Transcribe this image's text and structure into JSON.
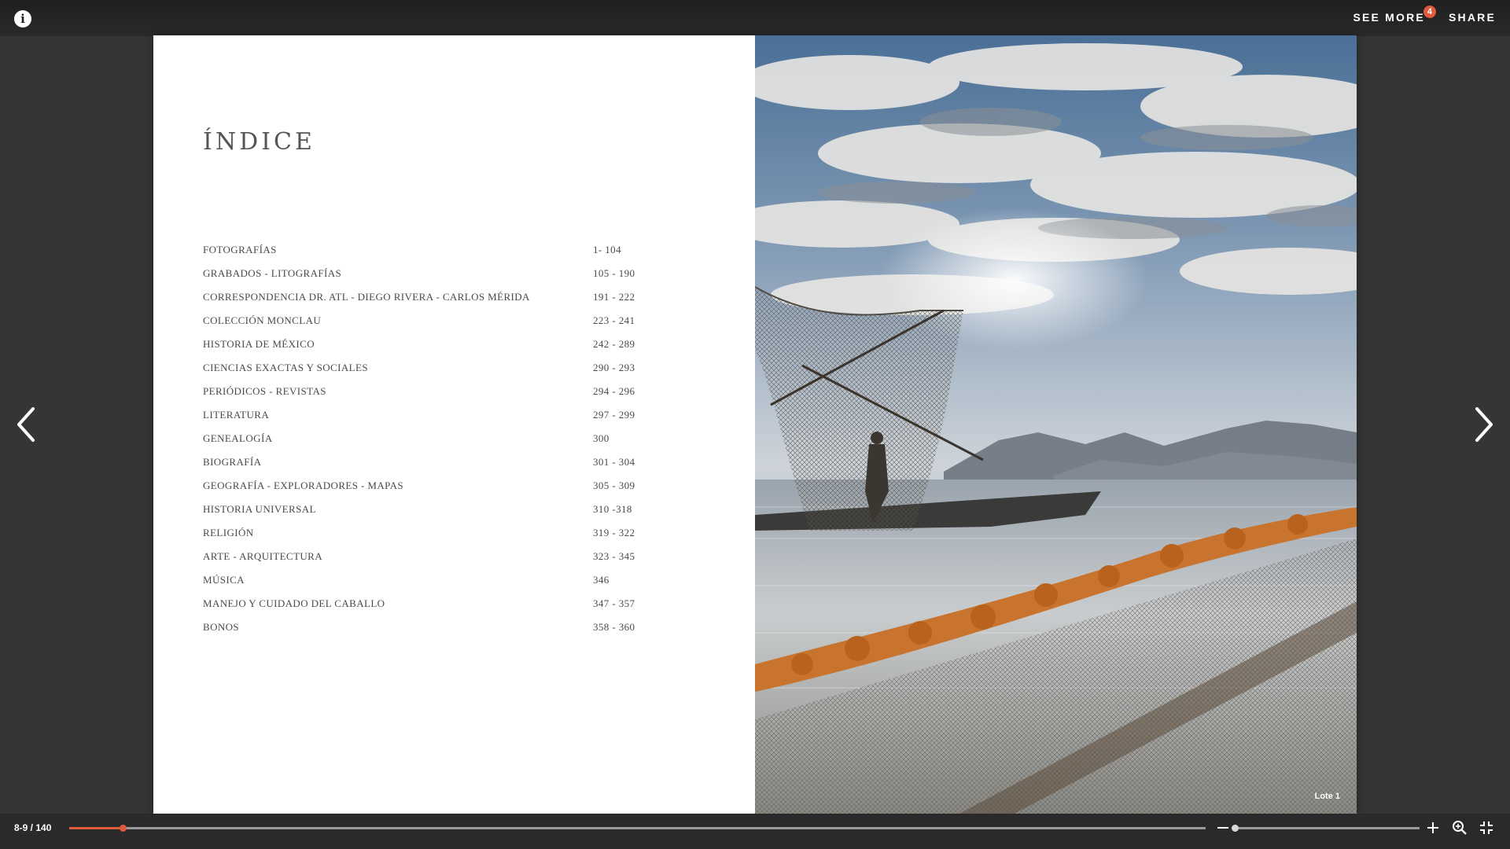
{
  "header": {
    "see_more_label": "SEE MORE",
    "see_more_badge": "4",
    "share_label": "SHARE"
  },
  "page_left": {
    "title": "ÍNDICE",
    "index": [
      {
        "label": "FOTOGRAFÍAS",
        "pages": "1- 104"
      },
      {
        "label": "GRABADOS - LITOGRAFÍAS",
        "pages": "105 - 190"
      },
      {
        "label": "CORRESPONDENCIA DR. ATL - DIEGO RIVERA - CARLOS MÉRIDA",
        "pages": "191 - 222"
      },
      {
        "label": "COLECCIÓN MONCLAU",
        "pages": "223 - 241"
      },
      {
        "label": "HISTORIA DE MÉXICO",
        "pages": "242 - 289"
      },
      {
        "label": "CIENCIAS EXACTAS Y SOCIALES",
        "pages": "290 - 293"
      },
      {
        "label": "PERIÓDICOS - REVISTAS",
        "pages": "294 - 296"
      },
      {
        "label": "LITERATURA",
        "pages": "297 - 299"
      },
      {
        "label": "GENEALOGÍA",
        "pages": "300"
      },
      {
        "label": "BIOGRAFÍA",
        "pages": "301 - 304"
      },
      {
        "label": "GEOGRAFÍA - EXPLORADORES - MAPAS",
        "pages": "305 - 309"
      },
      {
        "label": "HISTORIA UNIVERSAL",
        "pages": "310 -318"
      },
      {
        "label": "RELIGIÓN",
        "pages": "319 - 322"
      },
      {
        "label": "ARTE - ARQUITECTURA",
        "pages": "323 - 345"
      },
      {
        "label": "MÚSICA",
        "pages": "346"
      },
      {
        "label": "MANEJO Y CUIDADO DEL CABALLO",
        "pages": "347 - 357"
      },
      {
        "label": "BONOS",
        "pages": "358 - 360"
      }
    ]
  },
  "page_right": {
    "caption": "Lote 1"
  },
  "footer": {
    "page_counter": "8-9 / 140",
    "progress_fraction": 0.047,
    "zoom_fraction": 0.0
  },
  "icons": {
    "info": "info-icon",
    "prev": "chevron-left-icon",
    "next": "chevron-right-icon",
    "zoom_out": "minus-icon",
    "zoom_in": "plus-icon",
    "magnifier": "zoom-icon",
    "fullscreen": "exit-fullscreen-icon"
  },
  "colors": {
    "accent": "#e05a3c",
    "background": "#353535",
    "bar": "#2a2a2a",
    "page": "#ffffff",
    "text": "#4a4a4a"
  }
}
